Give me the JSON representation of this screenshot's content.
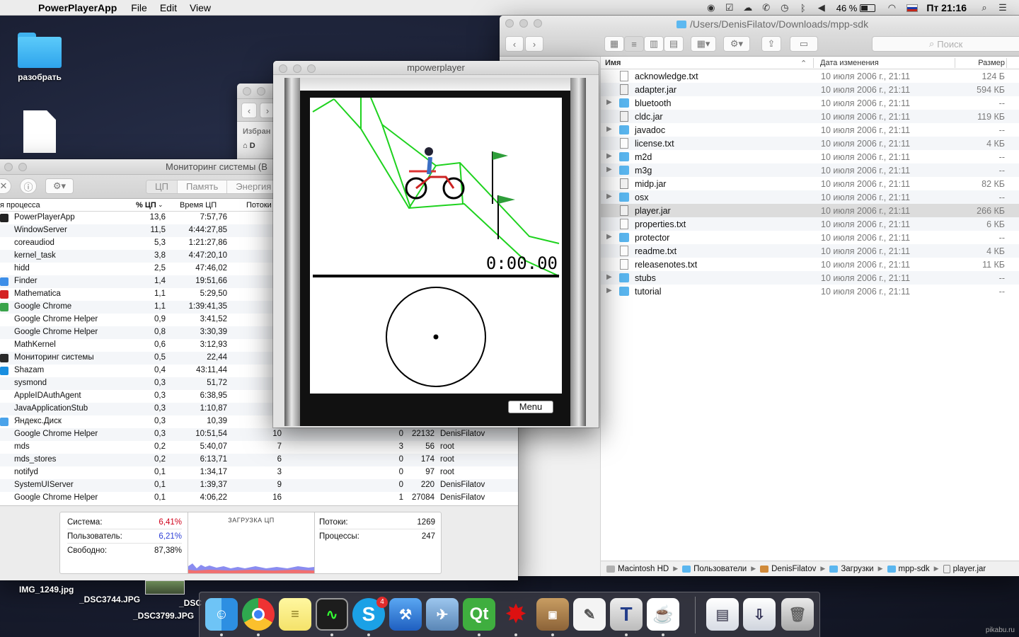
{
  "menubar": {
    "app_name": "PowerPlayerApp",
    "menus": [
      "File",
      "Edit",
      "View"
    ],
    "battery": "46 %",
    "battery_level": 0.46,
    "clock": "Пт 21:16"
  },
  "desktop": {
    "folder_label": "разобрать",
    "files": [
      "IMG_1249.jpg",
      "_DSC3744.JPG",
      "_DSC",
      "_DSC3799.JPG"
    ]
  },
  "finder": {
    "path_title": "/Users/DenisFilatov/Downloads/mpp-sdk",
    "search_placeholder": "Поиск",
    "columns": {
      "name": "Имя",
      "date": "Дата изменения",
      "size": "Размер"
    },
    "rows": [
      {
        "name": "acknowledge.txt",
        "date": "10 июля 2006 г., 21:11",
        "size": "124 Б",
        "kind": "file"
      },
      {
        "name": "adapter.jar",
        "date": "10 июля 2006 г., 21:11",
        "size": "594 КБ",
        "kind": "jar"
      },
      {
        "name": "bluetooth",
        "date": "10 июля 2006 г., 21:11",
        "size": "--",
        "kind": "folder"
      },
      {
        "name": "cldc.jar",
        "date": "10 июля 2006 г., 21:11",
        "size": "119 КБ",
        "kind": "jar"
      },
      {
        "name": "javadoc",
        "date": "10 июля 2006 г., 21:11",
        "size": "--",
        "kind": "folder"
      },
      {
        "name": "license.txt",
        "date": "10 июля 2006 г., 21:11",
        "size": "4 КБ",
        "kind": "file"
      },
      {
        "name": "m2d",
        "date": "10 июля 2006 г., 21:11",
        "size": "--",
        "kind": "folder"
      },
      {
        "name": "m3g",
        "date": "10 июля 2006 г., 21:11",
        "size": "--",
        "kind": "folder"
      },
      {
        "name": "midp.jar",
        "date": "10 июля 2006 г., 21:11",
        "size": "82 КБ",
        "kind": "jar"
      },
      {
        "name": "osx",
        "date": "10 июля 2006 г., 21:11",
        "size": "--",
        "kind": "folder"
      },
      {
        "name": "player.jar",
        "date": "10 июля 2006 г., 21:11",
        "size": "266 КБ",
        "kind": "jar"
      },
      {
        "name": "properties.txt",
        "date": "10 июля 2006 г., 21:11",
        "size": "6 КБ",
        "kind": "file"
      },
      {
        "name": "protector",
        "date": "10 июля 2006 г., 21:11",
        "size": "--",
        "kind": "folder"
      },
      {
        "name": "readme.txt",
        "date": "10 июля 2006 г., 21:11",
        "size": "4 КБ",
        "kind": "file"
      },
      {
        "name": "releasenotes.txt",
        "date": "10 июля 2006 г., 21:11",
        "size": "11 КБ",
        "kind": "file"
      },
      {
        "name": "stubs",
        "date": "10 июля 2006 г., 21:11",
        "size": "--",
        "kind": "folder"
      },
      {
        "name": "tutorial",
        "date": "10 июля 2006 г., 21:11",
        "size": "--",
        "kind": "folder"
      }
    ],
    "pathbar": [
      "Macintosh HD",
      "Пользователи",
      "DenisFilatov",
      "Загрузки",
      "mpp-sdk",
      "player.jar"
    ]
  },
  "finder_back": {
    "sidebar_heading": "Избран",
    "sidebar_item": "D"
  },
  "activity_monitor": {
    "title": "Мониторинг системы (В",
    "tabs": [
      "ЦП",
      "Память",
      "Энергия"
    ],
    "columns": {
      "name": "я процесса",
      "cpu": "% ЦП",
      "time": "Время ЦП",
      "threads": "Потоки"
    },
    "rows": [
      {
        "name": "PowerPlayerApp",
        "cpu": "13,6",
        "time": "7:57,76",
        "icon": "#222"
      },
      {
        "name": "WindowServer",
        "cpu": "11,5",
        "time": "4:44:27,85",
        "icon": ""
      },
      {
        "name": "coreaudiod",
        "cpu": "5,3",
        "time": "1:21:27,86",
        "icon": ""
      },
      {
        "name": "kernel_task",
        "cpu": "3,8",
        "time": "4:47:20,10",
        "icon": ""
      },
      {
        "name": "hidd",
        "cpu": "2,5",
        "time": "47:46,02",
        "icon": ""
      },
      {
        "name": "Finder",
        "cpu": "1,4",
        "time": "19:51,66",
        "icon": "#3d8ee8"
      },
      {
        "name": "Mathematica",
        "cpu": "1,1",
        "time": "5:29,50",
        "icon": "#d42222"
      },
      {
        "name": "Google Chrome",
        "cpu": "1,1",
        "time": "1:39:41,35",
        "icon": "#3aa34a"
      },
      {
        "name": "Google Chrome Helper",
        "cpu": "0,9",
        "time": "3:41,52",
        "icon": ""
      },
      {
        "name": "Google Chrome Helper",
        "cpu": "0,8",
        "time": "3:30,39",
        "icon": ""
      },
      {
        "name": "MathKernel",
        "cpu": "0,6",
        "time": "3:12,93",
        "icon": ""
      },
      {
        "name": "Мониторинг системы",
        "cpu": "0,5",
        "time": "22,44",
        "icon": "#2a2a2a"
      },
      {
        "name": "Shazam",
        "cpu": "0,4",
        "time": "43:11,44",
        "icon": "#1a8fe0"
      },
      {
        "name": "sysmond",
        "cpu": "0,3",
        "time": "51,72",
        "icon": ""
      },
      {
        "name": "AppleIDAuthAgent",
        "cpu": "0,3",
        "time": "6:38,95",
        "icon": ""
      },
      {
        "name": "JavaApplicationStub",
        "cpu": "0,3",
        "time": "1:10,87",
        "icon": ""
      },
      {
        "name": "Яндекс.Диск",
        "cpu": "0,3",
        "time": "10,39",
        "icon": "#4aa3ea"
      },
      {
        "name": "Google Chrome Helper",
        "cpu": "0,3",
        "time": "10:51,54",
        "threads": "10",
        "ports": "0",
        "pid": "22132",
        "user": "DenisFilatov",
        "icon": ""
      },
      {
        "name": "mds",
        "cpu": "0,2",
        "time": "5:40,07",
        "threads": "7",
        "ports": "3",
        "pid": "56",
        "user": "root",
        "icon": ""
      },
      {
        "name": "mds_stores",
        "cpu": "0,2",
        "time": "6:13,71",
        "threads": "6",
        "ports": "0",
        "pid": "174",
        "user": "root",
        "icon": ""
      },
      {
        "name": "notifyd",
        "cpu": "0,1",
        "time": "1:34,17",
        "threads": "3",
        "ports": "0",
        "pid": "97",
        "user": "root",
        "icon": ""
      },
      {
        "name": "SystemUIServer",
        "cpu": "0,1",
        "time": "1:39,37",
        "threads": "9",
        "ports": "0",
        "pid": "220",
        "user": "DenisFilatov",
        "icon": ""
      },
      {
        "name": "Google Chrome Helper",
        "cpu": "0,1",
        "time": "4:06,22",
        "threads": "16",
        "ports": "1",
        "pid": "27084",
        "user": "DenisFilatov",
        "icon": ""
      }
    ],
    "stats": {
      "system_label": "Система:",
      "system_value": "6,41%",
      "system_color": "#d0021b",
      "user_label": "Пользователь:",
      "user_value": "6,21%",
      "user_color": "#2d3fd6",
      "idle_label": "Свободно:",
      "idle_value": "87,38%",
      "graph_title": "ЗАГРУЗКА ЦП",
      "threads_label": "Потоки:",
      "threads_value": "1269",
      "processes_label": "Процессы:",
      "processes_value": "247"
    }
  },
  "mpowerplayer": {
    "title": "mpowerplayer",
    "timer": "0:00.00",
    "menu_label": "Menu"
  },
  "dock": {
    "skype_badge": "4",
    "items": [
      "finder-icon",
      "chrome-icon",
      "notes-icon",
      "activity-monitor-icon",
      "skype-icon",
      "xcode-icon",
      "preview-icon",
      "qt-creator-icon",
      "mathematica-icon",
      "archive-utility-icon",
      "textedit-icon",
      "textwrangler-icon",
      "java-icon",
      "documents-icon",
      "downloads-icon",
      "trash-icon"
    ]
  },
  "watermark": "pikabu.ru"
}
